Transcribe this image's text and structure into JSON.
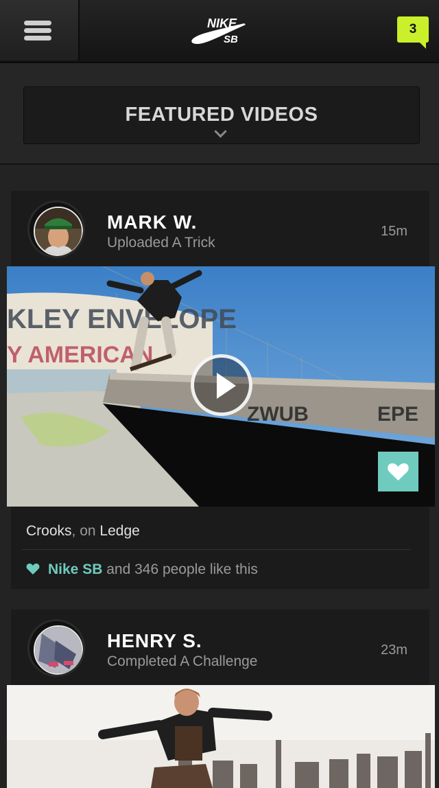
{
  "header": {
    "logo_line1": "NIKE",
    "logo_line2": "SB",
    "notification_count": "3",
    "accent": "#c9f02a"
  },
  "featured": {
    "title": "FEATURED VIDEOS"
  },
  "feed": [
    {
      "user": "MARK W.",
      "action": "Uploaded A Trick",
      "time": "15m",
      "trick": "Crooks",
      "on_label": ", on ",
      "obstacle": "Ledge",
      "likes_by": "Nike SB",
      "likes_rest": " and 346 people like this"
    },
    {
      "user": "HENRY S.",
      "action": "Completed A Challenge",
      "time": "23m"
    }
  ],
  "colors": {
    "teal": "#6fcbbe",
    "background": "#232323",
    "card": "#1b1b1b"
  }
}
